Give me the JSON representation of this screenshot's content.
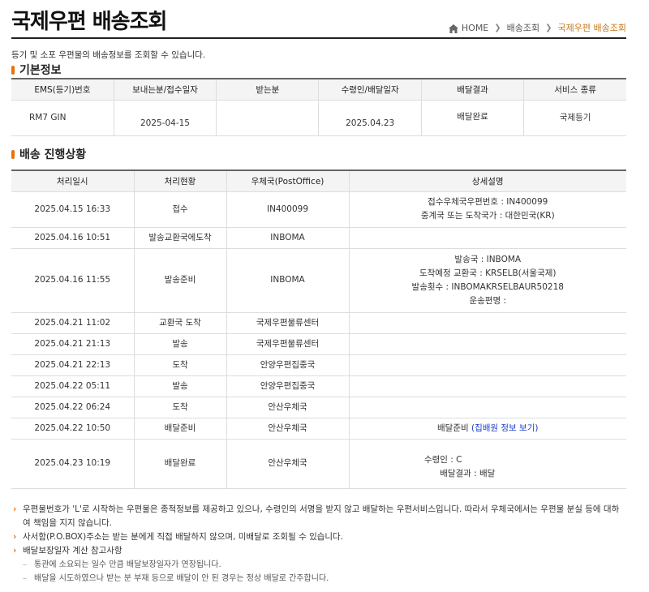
{
  "header": {
    "title": "국제우편 배송조회",
    "breadcrumb": [
      "HOME",
      "배송조회",
      "국제우편 배송조회"
    ]
  },
  "description": "등기 및 소포 우편물의 배송정보를 조회할 수 있습니다.",
  "basic_info": {
    "section_title": "기본정보",
    "columns": [
      "EMS(등기)번호",
      "보내는분/접수일자",
      "받는분",
      "수령인/배달일자",
      "배달결과",
      "서비스 종류"
    ],
    "row": {
      "tracking_no": "RM7           GIN",
      "sent_date": "2025-04-15",
      "receiver": "",
      "delivered_date": "2025.04.23",
      "result": "배달완료",
      "service": "국제등기"
    }
  },
  "progress": {
    "section_title": "배송 진행상황",
    "columns": [
      "처리일시",
      "처리현황",
      "우체국(PostOffice)",
      "상세설명"
    ],
    "rows": [
      {
        "datetime": "2025.04.15 16:33",
        "status": "접수",
        "office": "IN400099",
        "detail": [
          "접수우체국우편번호 : IN400099",
          "중계국 또는 도착국가 : 대한민국(KR)"
        ]
      },
      {
        "datetime": "2025.04.16 10:51",
        "status": "발송교환국에도착",
        "office": "INBOMA",
        "detail": []
      },
      {
        "datetime": "2025.04.16 11:55",
        "status": "발송준비",
        "office": "INBOMA",
        "detail": [
          "발송국 : INBOMA",
          "도착예정 교환국 : KRSELB(서울국제)",
          "발송횟수 : INBOMAKRSELBAUR50218",
          "운송편명 :"
        ]
      },
      {
        "datetime": "2025.04.21 11:02",
        "status": "교환국 도착",
        "office": "국제우편물류센터",
        "detail": []
      },
      {
        "datetime": "2025.04.21 21:13",
        "status": "발송",
        "office": "국제우편물류센터",
        "detail": []
      },
      {
        "datetime": "2025.04.21 22:13",
        "status": "도착",
        "office": "안양우편집중국",
        "detail": []
      },
      {
        "datetime": "2025.04.22 05:11",
        "status": "발송",
        "office": "안양우편집중국",
        "detail": []
      },
      {
        "datetime": "2025.04.22 06:24",
        "status": "도착",
        "office": "안산우체국",
        "detail": []
      },
      {
        "datetime": "2025.04.22 10:50",
        "status": "배달준비",
        "office": "안산우체국",
        "detail_prefix": "배달준비 ",
        "detail_link": "(집배원 정보 보기)"
      },
      {
        "datetime": "2025.04.23 10:19",
        "status": "배달완료",
        "office": "안산우체국",
        "detail": [
          "수령인 : C",
          "배달결과 : 배달"
        ]
      }
    ]
  },
  "notes": [
    "우편물번호가 'L'로 시작하는 우편물은 종적정보를 제공하고 있으나, 수령인의 서명을 받지 않고 배달하는 우편서비스입니다. 따라서 우체국에서는 우편물 분실 등에 대하여 책임을 지지 않습니다.",
    "사서함(P.O.BOX)주소는 받는 분에게 직접 배달하지 않으며, 미배달로 조회될 수 있습니다.",
    "배달보장일자 계산 참고사항"
  ],
  "sub_notes": [
    "통관에 소요되는 일수 만큼 배달보장일자가 연장됩니다.",
    "배달을 시도하였으나 받는 분 부재 등으로 배달이 안 된 경우는 정상 배달로 간주합니다."
  ]
}
